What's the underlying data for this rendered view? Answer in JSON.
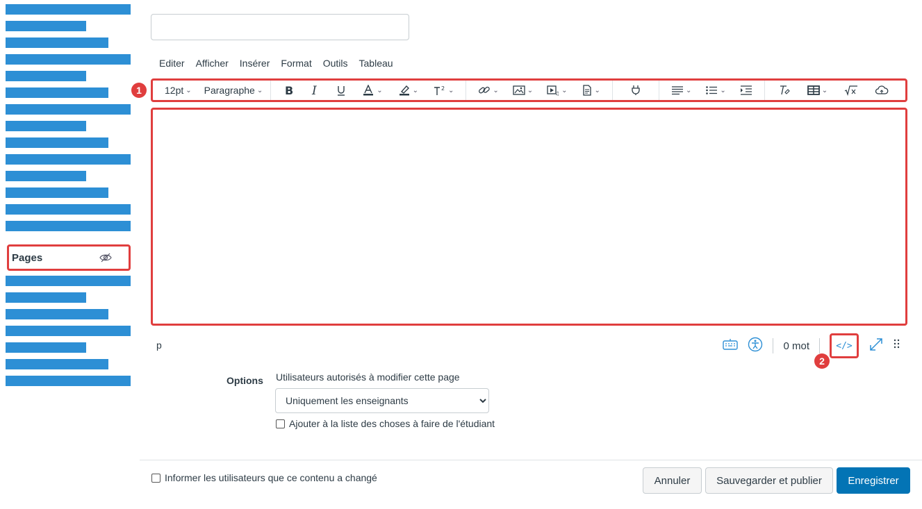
{
  "title_field": {
    "value": "",
    "placeholder": ""
  },
  "menubar": [
    "Editer",
    "Afficher",
    "Insérer",
    "Format",
    "Outils",
    "Tableau"
  ],
  "toolbar": {
    "font_size": "12pt",
    "block_format": "Paragraphe",
    "icons": [
      "bold-icon",
      "italic-icon",
      "underline-icon",
      "text-color-icon",
      "highlight-icon",
      "superscript-icon",
      "link-icon",
      "image-icon",
      "media-icon",
      "document-icon",
      "plugin-icon",
      "align-icon",
      "list-icon",
      "indent-icon",
      "clear-format-icon",
      "table-icon",
      "math-icon",
      "cloud-icon"
    ]
  },
  "callouts": {
    "toolbar": "1",
    "html_editor": "2"
  },
  "sidebar": {
    "active_item": "Pages",
    "accent": "#2d8fd5"
  },
  "status_bar": {
    "path": "p",
    "word_count": "0 mot",
    "html_toggle": "</>"
  },
  "options": {
    "label": "Options",
    "permissions_label": "Utilisateurs autorisés à modifier cette page",
    "permissions_value": "Uniquement les enseignants",
    "todo_label": "Ajouter à la liste des choses à faire de l'étudiant"
  },
  "footer": {
    "notify_label": "Informer les utilisateurs que ce contenu a changé",
    "cancel": "Annuler",
    "save_publish": "Sauvegarder et publier",
    "save": "Enregistrer"
  },
  "colors": {
    "highlight": "#e03e3e",
    "primary": "#0374b5"
  }
}
